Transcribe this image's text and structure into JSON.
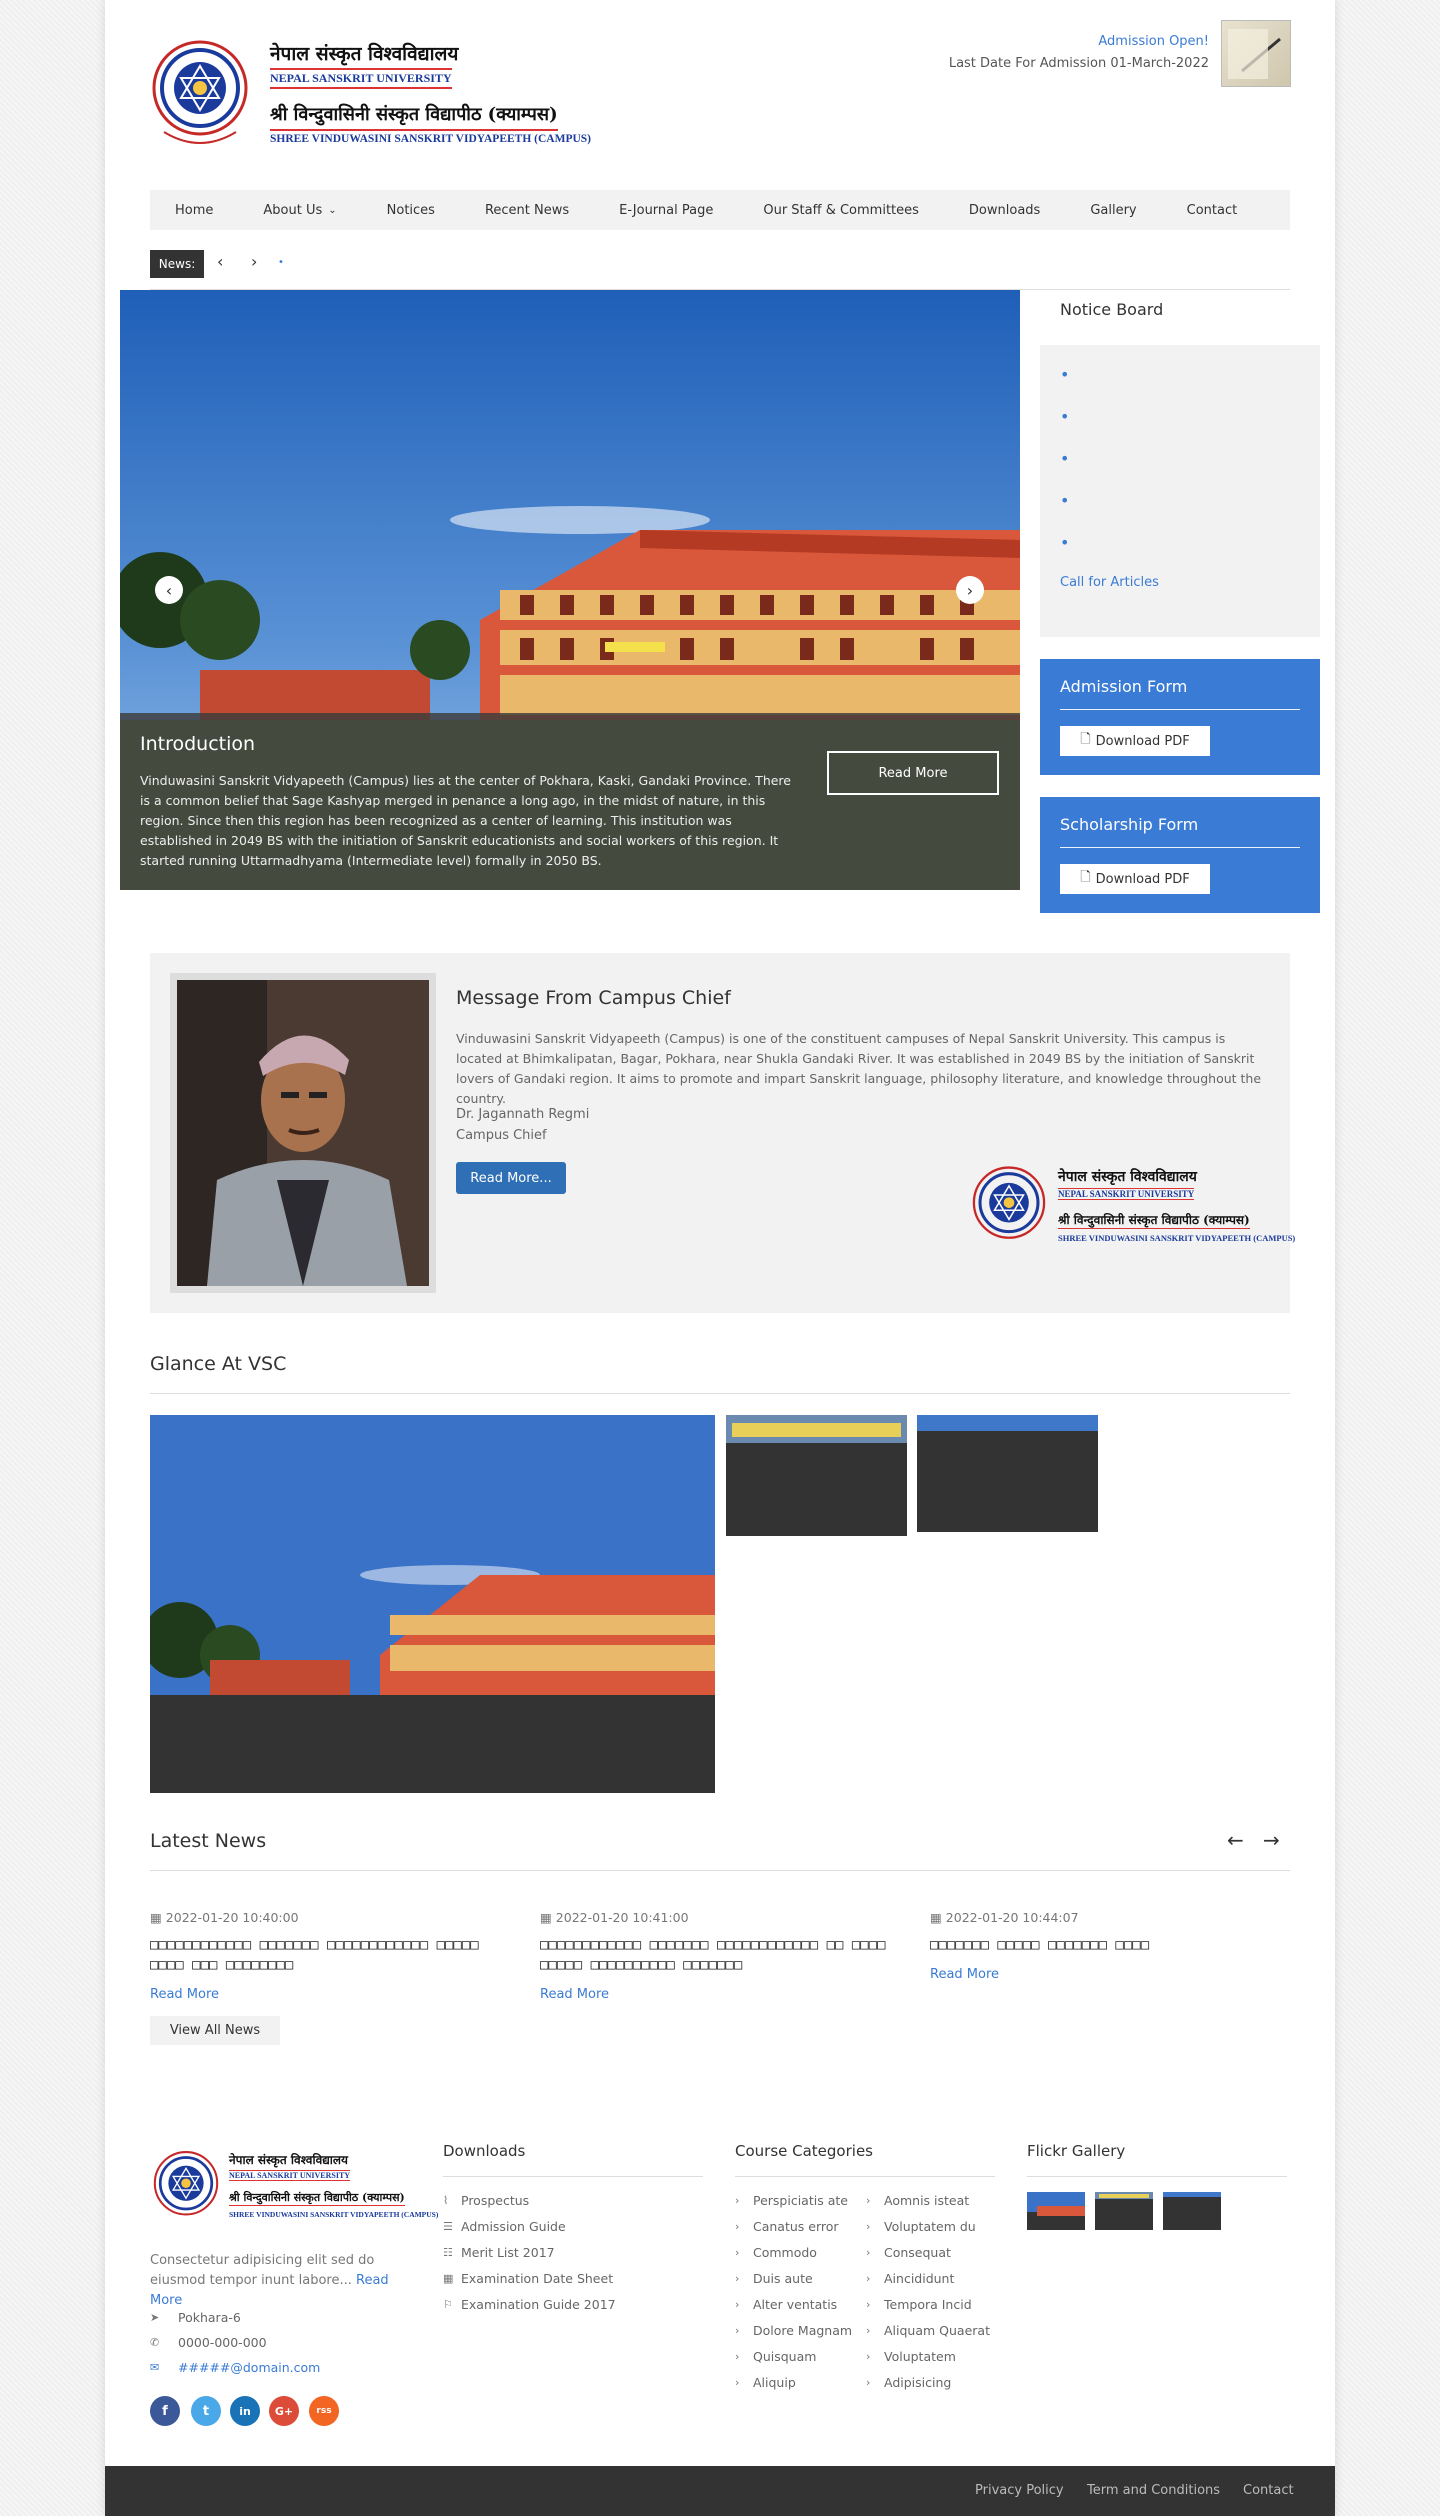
{
  "header": {
    "nsu_name_ne": "नेपाल संस्कृत विश्वविद्यालय",
    "nsu_name_en": "NEPAL SANSKRIT UNIVERSITY",
    "campus_name_ne": "श्री विन्दुवासिनी संस्कृत विद्यापीठ (क्याम्पस)",
    "campus_name_en": "SHREE VINDUWASINI SANSKRIT VIDYAPEETH (CAMPUS)",
    "admission_open": "Admission Open!",
    "admission_date": "Last Date For Admission 01-March-2022"
  },
  "nav": {
    "items": [
      "Home",
      "About Us",
      "Notices",
      "Recent News",
      "E-Journal Page",
      "Our Staff & Committees",
      "Downloads",
      "Gallery",
      "Contact"
    ]
  },
  "ticker": {
    "label": "News:",
    "prev": "‹",
    "next": "›",
    "dot": "•"
  },
  "slider": {
    "prev": "‹",
    "next": "›",
    "title": "Introduction",
    "text": "Vinduwasini Sanskrit Vidyapeeth (Campus) lies at the center of Pokhara, Kaski, Gandaki Province. There is a common belief that Sage Kashyap merged in penance a long ago, in the midst of nature, in this region. Since then this region has been recognized as a center of learning. This institution was established in 2049 BS with the initiation of Sanskrit educationists and social workers of this region. It started running Uttarmadhyama (Intermediate level) formally in 2050 BS.",
    "button": "Read More"
  },
  "notice_board": {
    "title": "Notice Board",
    "bullet": "•",
    "link": "Call for Articles"
  },
  "admission_form": {
    "title": "Admission Form",
    "button": "Download PDF"
  },
  "scholarship_form": {
    "title": "Scholarship Form",
    "button": "Download PDF"
  },
  "message": {
    "title": "Message From Campus Chief",
    "text": "Vinduwasini Sanskrit Vidyapeeth (Campus) is one of the constituent campuses of Nepal Sanskrit University. This campus is located at Bhimkalipatan, Bagar, Pokhara, near Shukla Gandaki River. It was established in 2049 BS by the initiation of Sanskrit lovers of Gandaki region. It aims to promote and impart Sanskrit language, philosophy literature, and knowledge throughout the country.",
    "name": "Dr. Jagannath Regmi",
    "role": "Campus Chief",
    "button": "Read More..."
  },
  "glance": {
    "title": "Glance At VSC"
  },
  "news": {
    "title": "Latest News",
    "prev": "←",
    "next": "→",
    "items": [
      {
        "date": "2022-01-20 10:40:00",
        "title": "□□□□□□□□□□□□ □□□□□□□ □□□□□□□□□□□□ □□□□□ □□□□ □□□ □□□□□□□□",
        "more": "Read More"
      },
      {
        "date": "2022-01-20 10:41:00",
        "title": "□□□□□□□□□□□□ □□□□□□□ □□□□□□□□□□□□ □□ □□□□ □□□□□ □□□□□□□□□□ □□□□□□□",
        "more": "Read More"
      },
      {
        "date": "2022-01-20 10:44:07",
        "title": "□□□□□□□ □□□□□ □□□□□□□ □□□□",
        "more": "Read More"
      }
    ],
    "view_all": "View All News"
  },
  "footer": {
    "about": "Consectetur adipisicing elit sed do eiusmod tempor inunt labore...",
    "about_more": "Read More",
    "address": "Pokhara-6",
    "phone": "0000-000-000",
    "email": "#####@domain.com",
    "downloads_title": "Downloads",
    "downloads": [
      "Prospectus",
      "Admission Guide",
      "Merit List 2017",
      "Examination Date Sheet",
      "Examination Guide 2017"
    ],
    "courses_title": "Course Categories",
    "courses_left": [
      "Perspiciatis ate",
      "Canatus error",
      "Commodo",
      "Duis aute",
      "Alter ventatis",
      "Dolore Magnam",
      "Quisquam",
      "Aliquip"
    ],
    "courses_right": [
      "Aomnis isteat",
      "Voluptatem du",
      "Consequat",
      "Aincididunt",
      "Tempora Incid",
      "Aliquam Quaerat",
      "Voluptatem",
      "Adipisicing"
    ],
    "flickr_title": "Flickr Gallery",
    "social": [
      "f",
      "t",
      "in",
      "G+",
      "rss"
    ],
    "social_colors": [
      "#3b5998",
      "#4aa8e8",
      "#1a73b6",
      "#dd4b39",
      "#f26522"
    ]
  },
  "bottom_links": [
    "Privacy Policy",
    "Term and Conditions",
    "Contact"
  ]
}
